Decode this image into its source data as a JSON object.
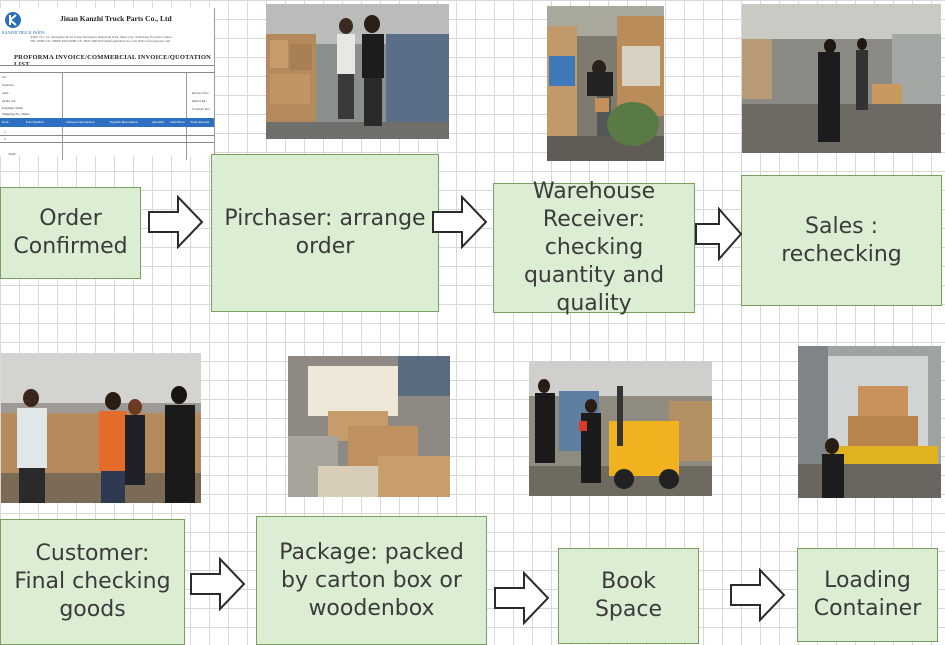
{
  "invoice": {
    "logo_text": "KANZHI TRUCK PARTS",
    "company": "Jinan Kanzhi Truck Parts Co., Ltd",
    "address_line1": "ADD: No. 52, Zhonghua Road Gang Zhonghou Industrial Park Jinan City, Shandong Province China",
    "address_line2": "TEL:0086-531-59966 FAX:0086-531-8825-966 Email:info@kzhtrucks.com Web:www.kzparts.com",
    "heading": "PROFORMA   INVOICE/COMMERCIAL   INVOICE/QUOTATION LIST",
    "left_labels": [
      "To:",
      "Cust.No.",
      "Add:",
      "Order ref:",
      "Payment Term:",
      "Shipping No. Mark:"
    ],
    "right_labels": [
      "Invoice No.:",
      "Date/s Dt.:",
      "Contract No.:"
    ],
    "table_headers": [
      "Item",
      "Part Number",
      "Chinese Description",
      "English Description",
      "Quantity",
      "Unit/Piece",
      "Total Amount"
    ],
    "rows": [
      "1",
      "2"
    ],
    "footer": "Total:"
  },
  "flow": {
    "step1": "Order Confirmed",
    "step2": "Pirchaser: arrange order",
    "step3": "Warehouse Receiver: checking quantity and quality",
    "step4": "Sales : rechecking",
    "step5": "Customer: Final checking goods",
    "step6": "Package: packed by carton box or woodenbox",
    "step7": "Book Space",
    "step8": "Loading Container"
  },
  "colors": {
    "box_fill": "#dbeed3",
    "box_border": "#7aa05f",
    "grid": "#d8d8d8"
  }
}
